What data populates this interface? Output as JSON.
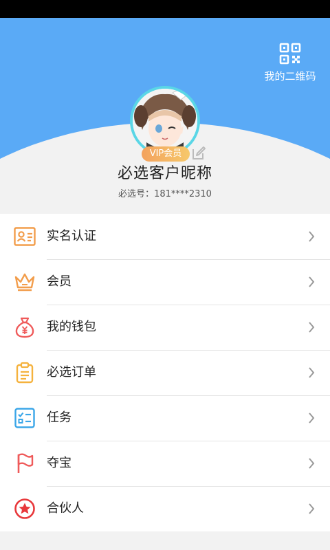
{
  "header": {
    "qr_label": "我的二维码",
    "vip_badge": "VIP会员",
    "nickname": "必选客户昵称",
    "account_id": "必选号：181****2310",
    "accent_color": "#5aaaf6"
  },
  "menu": {
    "items": [
      {
        "label": "实名认证",
        "icon": "id-card-icon",
        "color": "#f29d4b"
      },
      {
        "label": "会员",
        "icon": "crown-icon",
        "color": "#f29d4b"
      },
      {
        "label": "我的钱包",
        "icon": "money-bag-icon",
        "color": "#ef5a5a"
      },
      {
        "label": "必选订单",
        "icon": "clipboard-icon",
        "color": "#f5b23d"
      },
      {
        "label": "任务",
        "icon": "checklist-icon",
        "color": "#3aa6e8"
      },
      {
        "label": "夺宝",
        "icon": "flag-icon",
        "color": "#ef5a5a"
      },
      {
        "label": "合伙人",
        "icon": "star-badge-icon",
        "color": "#e8383b"
      }
    ]
  }
}
